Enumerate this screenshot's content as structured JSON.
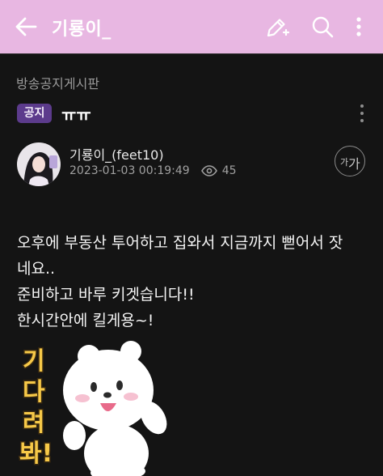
{
  "topbar": {
    "title": "기룡이_",
    "bg": "#e8b7e2"
  },
  "post": {
    "board": "방송공지게시판",
    "badge": "공지",
    "title": "ㅠㅠ",
    "author": "기룡이_(feet10)",
    "date": "2023-01-03 00:19:49",
    "views": "45",
    "font_button_small": "가",
    "font_button_large": "가",
    "body": [
      "오후에 부동산 투어하고 집와서 지금까지 뻗어서 잣",
      "네요..",
      "준비하고 바루 키겟습니다!!",
      "한시간안에 킬게용~!"
    ],
    "sticker_text": [
      "기",
      "다",
      "려",
      "봐!"
    ]
  },
  "icons": [
    "back-arrow-icon",
    "pencil-plus-icon",
    "search-icon",
    "more-vert-icon",
    "eye-icon"
  ]
}
